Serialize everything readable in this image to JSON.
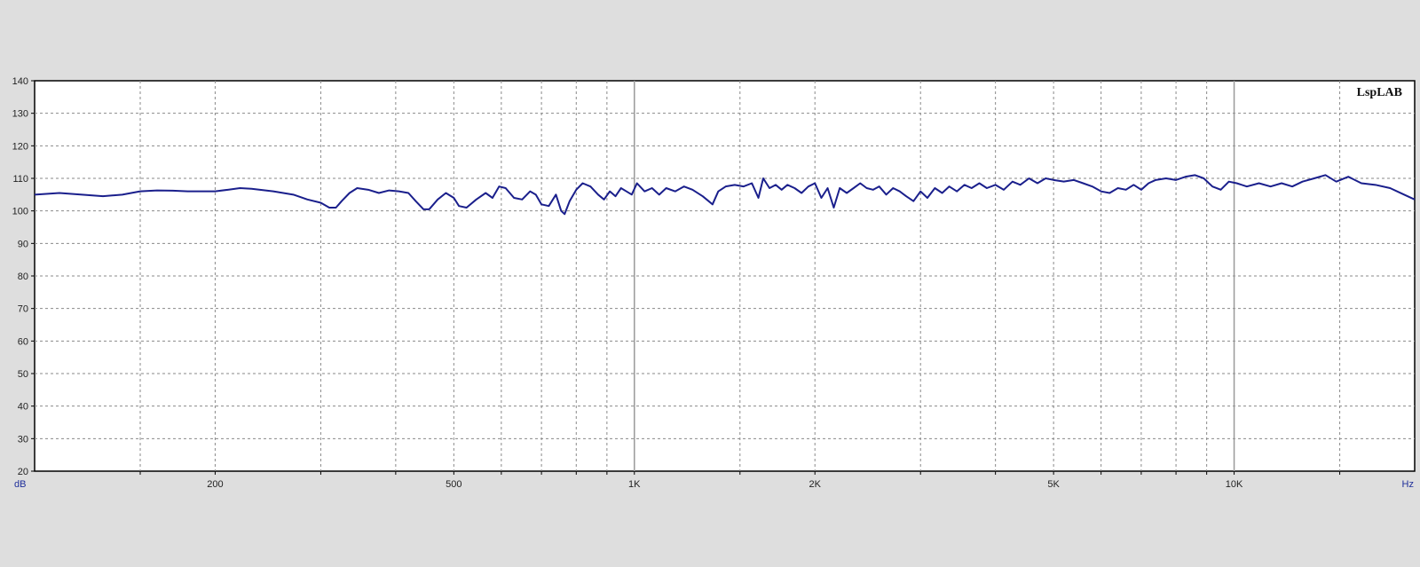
{
  "chart_data": {
    "type": "line",
    "brand": "LspLAB",
    "y_unit_label": "dB",
    "x_unit_label": "Hz",
    "x_scale": "log",
    "xlim": [
      100,
      20000
    ],
    "ylim": [
      20,
      140
    ],
    "grid": true,
    "y_ticks": [
      20,
      30,
      40,
      50,
      60,
      70,
      80,
      90,
      100,
      110,
      120,
      130,
      140
    ],
    "x_ticks_labeled": [
      {
        "value": 200,
        "label": "200"
      },
      {
        "value": 500,
        "label": "500"
      },
      {
        "value": 1000,
        "label": "1K"
      },
      {
        "value": 2000,
        "label": "2K"
      },
      {
        "value": 5000,
        "label": "5K"
      },
      {
        "value": 10000,
        "label": "10K"
      }
    ],
    "x_grid_minor": [
      150,
      300,
      400,
      600,
      700,
      800,
      900,
      1500,
      3000,
      4000,
      6000,
      7000,
      8000,
      9000,
      15000
    ],
    "x_grid_major": [
      1000,
      10000
    ],
    "line_color": "#1a1f8c",
    "series": [
      {
        "values": [
          [
            100,
            105
          ],
          [
            110,
            105.5
          ],
          [
            120,
            105
          ],
          [
            130,
            104.5
          ],
          [
            140,
            105
          ],
          [
            150,
            106
          ],
          [
            160,
            106.3
          ],
          [
            170,
            106.2
          ],
          [
            180,
            106
          ],
          [
            200,
            106
          ],
          [
            210,
            106.5
          ],
          [
            220,
            107
          ],
          [
            230,
            106.8
          ],
          [
            250,
            106
          ],
          [
            270,
            105
          ],
          [
            285,
            103.5
          ],
          [
            300,
            102.5
          ],
          [
            310,
            101
          ],
          [
            318,
            101
          ],
          [
            325,
            103
          ],
          [
            335,
            105.5
          ],
          [
            345,
            107
          ],
          [
            360,
            106.5
          ],
          [
            375,
            105.5
          ],
          [
            390,
            106.3
          ],
          [
            405,
            106
          ],
          [
            420,
            105.5
          ],
          [
            432,
            103
          ],
          [
            445,
            100.5
          ],
          [
            455,
            100.5
          ],
          [
            470,
            103.5
          ],
          [
            485,
            105.5
          ],
          [
            500,
            104
          ],
          [
            510,
            101.5
          ],
          [
            525,
            101
          ],
          [
            545,
            103.5
          ],
          [
            565,
            105.5
          ],
          [
            580,
            104
          ],
          [
            595,
            107.5
          ],
          [
            610,
            107
          ],
          [
            630,
            104
          ],
          [
            650,
            103.5
          ],
          [
            670,
            106
          ],
          [
            685,
            105
          ],
          [
            700,
            102
          ],
          [
            720,
            101.5
          ],
          [
            740,
            105
          ],
          [
            755,
            100
          ],
          [
            765,
            99
          ],
          [
            780,
            103
          ],
          [
            800,
            106.5
          ],
          [
            820,
            108.5
          ],
          [
            845,
            107.5
          ],
          [
            870,
            105
          ],
          [
            890,
            103.5
          ],
          [
            910,
            106
          ],
          [
            930,
            104.5
          ],
          [
            950,
            107
          ],
          [
            970,
            106
          ],
          [
            990,
            105
          ],
          [
            1010,
            108.5
          ],
          [
            1040,
            106
          ],
          [
            1070,
            107
          ],
          [
            1100,
            105
          ],
          [
            1130,
            107
          ],
          [
            1170,
            106
          ],
          [
            1210,
            107.5
          ],
          [
            1250,
            106.5
          ],
          [
            1300,
            104.5
          ],
          [
            1330,
            103
          ],
          [
            1350,
            102
          ],
          [
            1380,
            106
          ],
          [
            1420,
            107.5
          ],
          [
            1470,
            108
          ],
          [
            1520,
            107.5
          ],
          [
            1570,
            108.5
          ],
          [
            1610,
            104
          ],
          [
            1640,
            110
          ],
          [
            1680,
            107
          ],
          [
            1720,
            108
          ],
          [
            1760,
            106.5
          ],
          [
            1800,
            108
          ],
          [
            1850,
            107
          ],
          [
            1900,
            105.5
          ],
          [
            1950,
            107.5
          ],
          [
            2000,
            108.5
          ],
          [
            2050,
            104
          ],
          [
            2100,
            107
          ],
          [
            2150,
            101
          ],
          [
            2200,
            107
          ],
          [
            2260,
            105.5
          ],
          [
            2320,
            107
          ],
          [
            2380,
            108.5
          ],
          [
            2440,
            107
          ],
          [
            2500,
            106.5
          ],
          [
            2560,
            107.5
          ],
          [
            2630,
            105
          ],
          [
            2700,
            107
          ],
          [
            2770,
            106
          ],
          [
            2840,
            104.5
          ],
          [
            2920,
            103
          ],
          [
            3000,
            106
          ],
          [
            3080,
            104
          ],
          [
            3170,
            107
          ],
          [
            3260,
            105.5
          ],
          [
            3350,
            107.5
          ],
          [
            3450,
            106
          ],
          [
            3550,
            108
          ],
          [
            3650,
            107
          ],
          [
            3760,
            108.5
          ],
          [
            3870,
            107
          ],
          [
            4000,
            108
          ],
          [
            4130,
            106.5
          ],
          [
            4270,
            109
          ],
          [
            4400,
            108
          ],
          [
            4550,
            110
          ],
          [
            4700,
            108.5
          ],
          [
            4850,
            110
          ],
          [
            5000,
            109.5
          ],
          [
            5200,
            109
          ],
          [
            5400,
            109.5
          ],
          [
            5600,
            108.5
          ],
          [
            5800,
            107.5
          ],
          [
            6000,
            106
          ],
          [
            6200,
            105.5
          ],
          [
            6400,
            107
          ],
          [
            6600,
            106.5
          ],
          [
            6800,
            108
          ],
          [
            7000,
            106.5
          ],
          [
            7200,
            108.5
          ],
          [
            7400,
            109.5
          ],
          [
            7700,
            110
          ],
          [
            8000,
            109.5
          ],
          [
            8300,
            110.5
          ],
          [
            8600,
            111
          ],
          [
            8900,
            110
          ],
          [
            9200,
            107.5
          ],
          [
            9500,
            106.5
          ],
          [
            9800,
            109
          ],
          [
            10100,
            108.5
          ],
          [
            10500,
            107.5
          ],
          [
            11000,
            108.5
          ],
          [
            11500,
            107.5
          ],
          [
            12000,
            108.5
          ],
          [
            12500,
            107.5
          ],
          [
            13000,
            109
          ],
          [
            13600,
            110
          ],
          [
            14200,
            111
          ],
          [
            14800,
            109
          ],
          [
            15500,
            110.5
          ],
          [
            16300,
            108.5
          ],
          [
            17200,
            108
          ],
          [
            18200,
            107
          ],
          [
            19200,
            105
          ],
          [
            20000,
            103.5
          ]
        ]
      }
    ]
  }
}
